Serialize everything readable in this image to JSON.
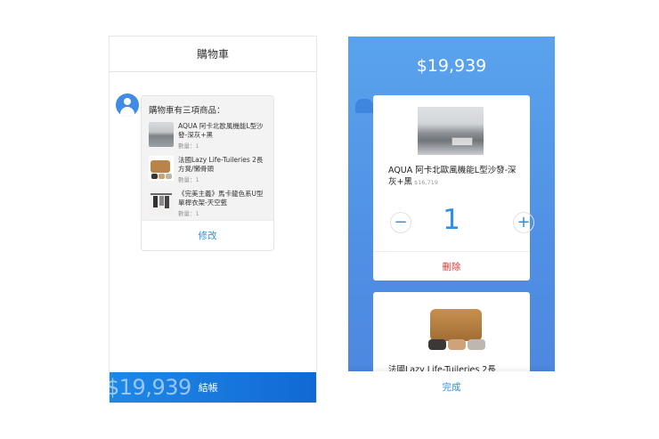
{
  "left": {
    "header_title": "購物車",
    "summary": "購物車有三項商品：",
    "items": [
      {
        "name": "AQUA 阿卡北歐風機能L型沙發-深灰+黑",
        "qty": "數量：1"
      },
      {
        "name": "法國Lazy Life-Tuileries 2長方凳/懶骨頭",
        "qty": "數量：1"
      },
      {
        "name": "《完美主義》馬卡龍色系U型單桿衣架-天空藍",
        "qty": "數量：1"
      }
    ],
    "edit_label": "修改",
    "checkout_amount": "$19,939",
    "checkout_label": "結帳"
  },
  "right": {
    "total": "$19,939",
    "product1": {
      "name": "AQUA 阿卡北歐風機能L型沙發-深灰+黑",
      "price": "$16,719",
      "quantity": "1",
      "minus": "−",
      "plus": "+",
      "delete_label": "刪除"
    },
    "product2": {
      "name": "法國Lazy Life-Tuileries 2長"
    },
    "done_label": "完成"
  },
  "colors": {
    "accent_blue": "#2f8fe0",
    "delete_red": "#e0332f",
    "checkout_bar": "#1a7ee0"
  },
  "icons": [
    "user-avatar-icon",
    "minus-icon",
    "plus-icon"
  ]
}
